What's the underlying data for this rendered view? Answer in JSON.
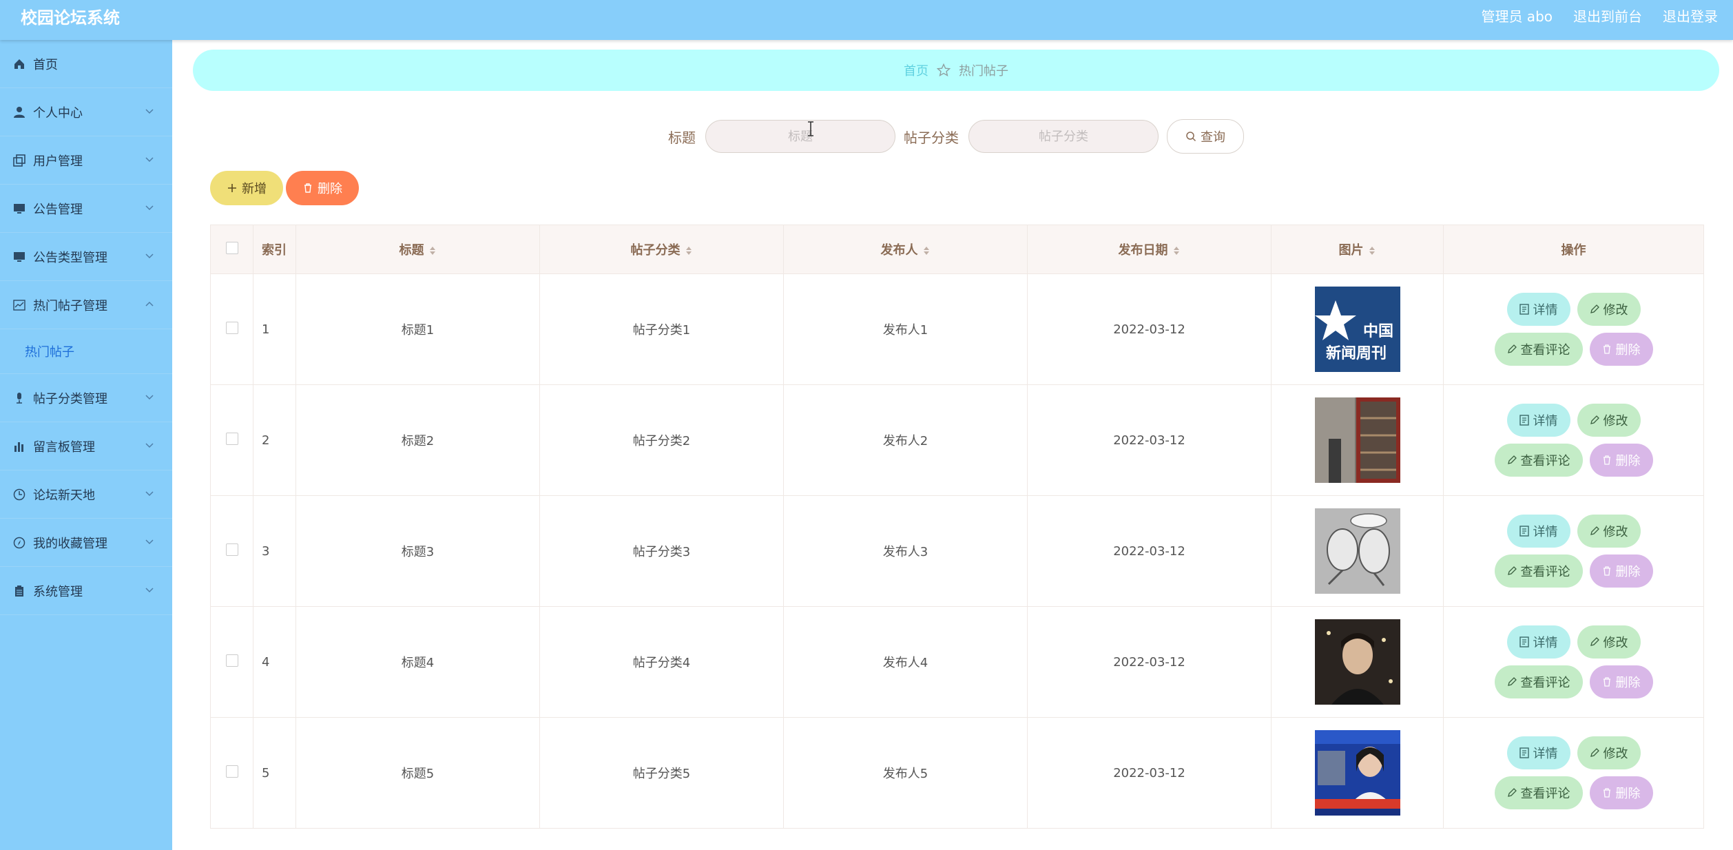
{
  "header": {
    "title": "校园论坛系统",
    "admin_label": "管理员 abo",
    "front_link": "退出到前台",
    "logout_link": "退出登录"
  },
  "sidebar": {
    "items": [
      {
        "label": "首页",
        "icon": "home-icon"
      },
      {
        "label": "个人中心",
        "icon": "user-icon"
      },
      {
        "label": "用户管理",
        "icon": "copy-icon"
      },
      {
        "label": "公告管理",
        "icon": "monitor-icon"
      },
      {
        "label": "公告类型管理",
        "icon": "monitor-icon"
      },
      {
        "label": "热门帖子管理",
        "icon": "chart-icon",
        "expanded": true
      },
      {
        "label": "帖子分类管理",
        "icon": "mic-icon"
      },
      {
        "label": "留言板管理",
        "icon": "bar-icon"
      },
      {
        "label": "论坛新天地",
        "icon": "clock-icon"
      },
      {
        "label": "我的收藏管理",
        "icon": "compass-icon"
      },
      {
        "label": "系统管理",
        "icon": "clipboard-icon"
      }
    ],
    "sub_item": "热门帖子"
  },
  "breadcrumb": {
    "home": "首页",
    "current": "热门帖子"
  },
  "search": {
    "title_label": "标题",
    "title_placeholder": "标题",
    "category_label": "帖子分类",
    "category_placeholder": "帖子分类",
    "query_button": "查询"
  },
  "actions": {
    "add": "新增",
    "delete": "删除"
  },
  "table": {
    "columns": [
      "索引",
      "标题",
      "帖子分类",
      "发布人",
      "发布日期",
      "图片",
      "操作"
    ],
    "rows": [
      {
        "index": "1",
        "title": "标题1",
        "category": "帖子分类1",
        "author": "发布人1",
        "date": "2022-03-12"
      },
      {
        "index": "2",
        "title": "标题2",
        "category": "帖子分类2",
        "author": "发布人2",
        "date": "2022-03-12"
      },
      {
        "index": "3",
        "title": "标题3",
        "category": "帖子分类3",
        "author": "发布人3",
        "date": "2022-03-12"
      },
      {
        "index": "4",
        "title": "标题4",
        "category": "帖子分类4",
        "author": "发布人4",
        "date": "2022-03-12"
      },
      {
        "index": "5",
        "title": "标题5",
        "category": "帖子分类5",
        "author": "发布人5",
        "date": "2022-03-12"
      }
    ],
    "ops": {
      "detail": "详情",
      "edit": "修改",
      "comment": "查看评论",
      "delete": "删除"
    }
  },
  "thumb_text": {
    "line1": "中国",
    "line2": "新闻周刊"
  },
  "colors": {
    "header": "#87cefa",
    "breadcrumb": "#b8fffe",
    "add": "#f0df78",
    "delete": "#ff7f50"
  }
}
